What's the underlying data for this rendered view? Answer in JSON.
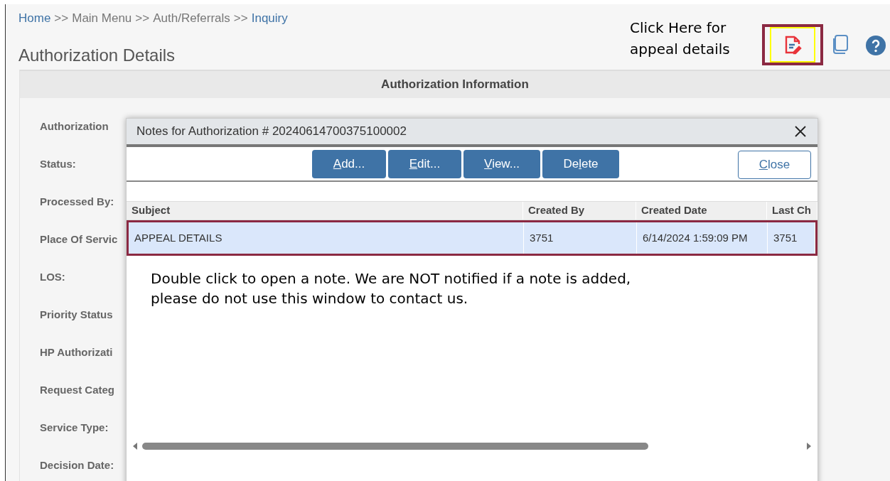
{
  "breadcrumb": [
    {
      "kind": "link",
      "text": "Home"
    },
    {
      "kind": "separator",
      "text": ">>"
    },
    {
      "kind": "plain",
      "text": "Main Menu"
    },
    {
      "kind": "separator",
      "text": ">>"
    },
    {
      "kind": "plain",
      "text": "Auth/Referrals"
    },
    {
      "kind": "separator",
      "text": ">>"
    },
    {
      "kind": "link",
      "text": "Inquiry"
    }
  ],
  "page_title": "Authorization Details",
  "callout": {
    "text": "Click Here for appeal details"
  },
  "section_header": "Authorization Information",
  "field_labels": [
    "Authorization",
    "Status:",
    "Processed By:",
    "Place Of Servic",
    "LOS:",
    "Priority Status",
    "HP Authorizati",
    "Request Categ",
    "Service Type:",
    "Decision Date:"
  ],
  "dialog": {
    "title": "Notes for Authorization # 20240614700375100002",
    "buttons": [
      {
        "key": "A",
        "after": "dd..."
      },
      {
        "key": "E",
        "after": "dit..."
      },
      {
        "key": "V",
        "after": "iew..."
      },
      {
        "before": "De",
        "key": "l",
        "after": "ete"
      }
    ],
    "close_button": {
      "key": "C",
      "after": "lose"
    },
    "columns": [
      "Subject",
      "Created By",
      "Created Date",
      "Last Ch"
    ],
    "rows": [
      {
        "selected": true,
        "cells": [
          "APPEAL DETAILS",
          "3751",
          "6/14/2024 1:59:09 PM",
          "3751"
        ]
      }
    ],
    "note": "Double click to open a note. We are NOT notified if a note is added, please do not use this window to contact us."
  }
}
